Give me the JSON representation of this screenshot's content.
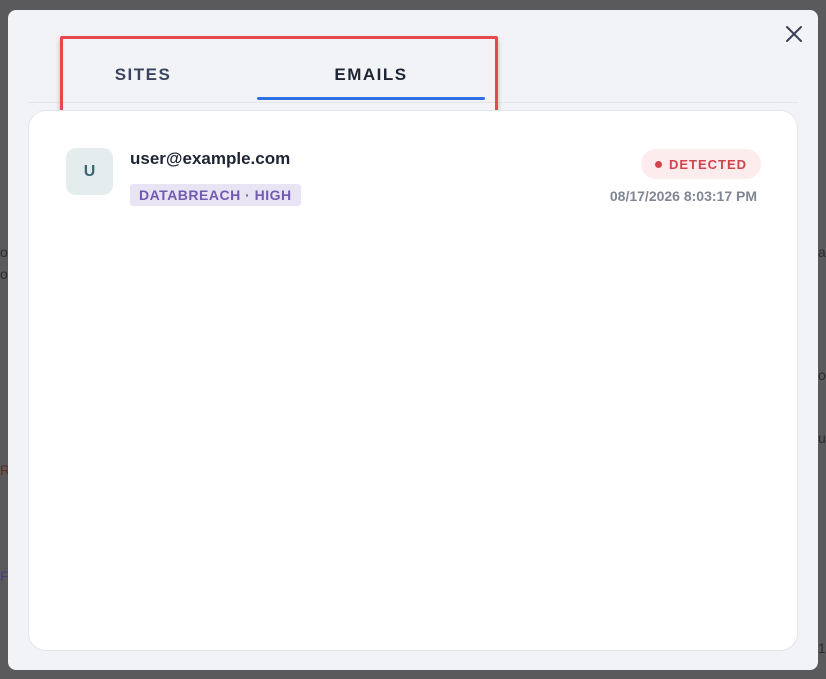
{
  "background": {
    "fragments": [
      "o",
      "o",
      "a",
      "o",
      "u",
      "R",
      "F",
      "1"
    ]
  },
  "modal": {
    "close_icon": "close-icon",
    "tabs": [
      {
        "label": "SITES",
        "active": false
      },
      {
        "label": "EMAILS",
        "active": true
      }
    ],
    "accent_color": "#2f6fe4",
    "highlight_color": "#e5484d"
  },
  "emails": {
    "items": [
      {
        "avatar_letter": "U",
        "address": "user@example.com",
        "tag": "DATABREACH · HIGH",
        "status": "DETECTED",
        "status_color": "#d0454c",
        "timestamp": "08/17/2026 8:03:17 PM"
      }
    ]
  }
}
